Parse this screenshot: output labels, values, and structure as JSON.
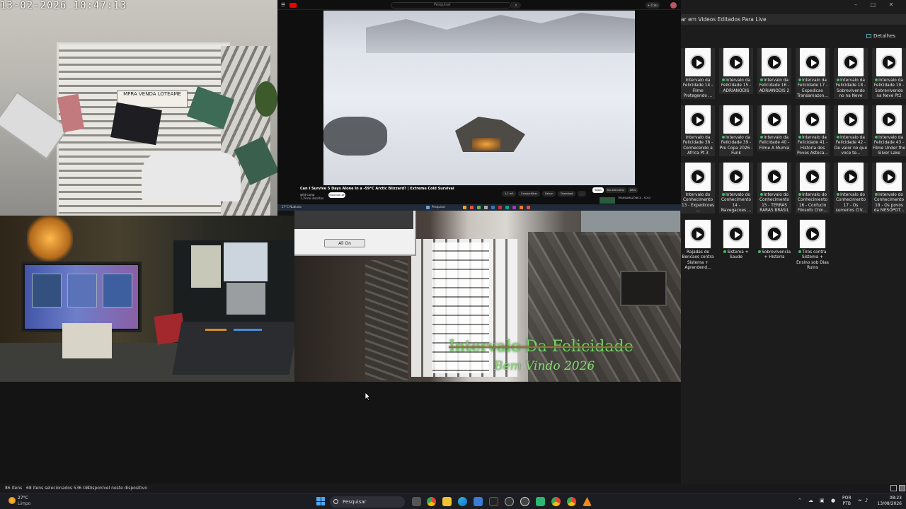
{
  "camera": {
    "timestamp": "13-02-2026  10:47:13",
    "sign_text": "MPRA  VENDA  LOTEAME"
  },
  "youtube": {
    "search_placeholder": "Pesquisar",
    "create_label": "+ Criar",
    "video_title": "Can I Survive 5 Days Alone In a -59°C Arctic Blizzard? | Extreme Cold Survival",
    "channel": "wild camp",
    "channel_subs": "7,79 mi inscritos",
    "subscribe_label": "Inscrever-se",
    "actions": [
      "1,1 mil",
      "Compartilhar",
      "Salvar",
      "Download",
      "..."
    ],
    "chips": [
      {
        "label": "Todos",
        "active": true
      },
      {
        "label": "Do wild camp",
        "active": false
      },
      {
        "label": "Afins",
        "active": false
      }
    ],
    "suggestion_title": "TRANSAMAZÔNICA - SOLO"
  },
  "mini_taskbar": {
    "search": "Pesquisar",
    "left_text": "27°C Nublado"
  },
  "room": {
    "dialog_button": "All On",
    "overlay_line1": "Intervalo Da Felicidade",
    "overlay_line2": "Bem Vindo 2026"
  },
  "explorer": {
    "address": "ar em Videos Editados Para Live",
    "details_label": "Detalhes",
    "files": [
      {
        "name": "Intervalo da Felicidade 14 - Filme Protegendo ...",
        "synced": false
      },
      {
        "name": "Intervalo da Felicidade 15 - ADRIANODIS",
        "synced": true
      },
      {
        "name": "Intervalo da Felicidade 16 - ADRIANODIS 2",
        "synced": true
      },
      {
        "name": "Intervalo da Felicidade 17 - Expedicao Transamazon...",
        "synced": true
      },
      {
        "name": "Intervalo da Felicidade 18 - Sobrevivendo no na Neve",
        "synced": true
      },
      {
        "name": "Intervalo da Felicidade 19 - Sobrevivendo na Neve Pt2",
        "synced": true
      },
      {
        "name": "Intervalo da Felicidade 38 - Conhecendo a Africa Pt 3",
        "synced": false
      },
      {
        "name": "Intervalo da Felicidade 39 - Pre Copa 2026 - Funk",
        "synced": true
      },
      {
        "name": "Intervalo da Felicidade 40 - Filme A Mumia",
        "synced": true
      },
      {
        "name": "Intervalo da Felicidade 41 - Historia dos Povos Asteca...",
        "synced": true
      },
      {
        "name": "Intervalo da Felicidade 42 - De valor no que voce te...",
        "synced": true
      },
      {
        "name": "Intervalo da Felicidade 43 - Filme Under the Silver Lake",
        "synced": true
      },
      {
        "name": "Intervalo do Conhecimento 13 - Expedicoes ...",
        "synced": false
      },
      {
        "name": "Intervalo do Conhecimento 14 - Navegacoes ...",
        "synced": true
      },
      {
        "name": "Intervalo do Conhecimento 15 - TERRAS RARAS BRASIL",
        "synced": true
      },
      {
        "name": "Intervalo do Conhecimento 16 - Confucio Filosofo Chin...",
        "synced": true
      },
      {
        "name": "Intervalo do Conhecimento 17 - Os sumerios CIV...",
        "synced": true
      },
      {
        "name": "Intervalo do Conhecimento 18 - Os povos da MESOPOT...",
        "synced": true
      },
      {
        "name": "Rajadas de Bencaos contra Sistema + Aprendend...",
        "synced": false
      },
      {
        "name": "Sistema + Saude",
        "synced": true
      },
      {
        "name": "Sobrevivencia + Historia",
        "synced": true
      },
      {
        "name": "Tiros contra Sistema + Ensino sob Dias Ruins",
        "synced": true
      }
    ]
  },
  "statusbar": {
    "items_count": "86 itens",
    "selected": "68 itens selecionados  536 GB",
    "availability": "Disponível neste dispositivo"
  },
  "taskbar": {
    "temperature": "27°C",
    "condition": "Limpo",
    "search_label": "Pesquisar",
    "language": "POR",
    "layout": "PTB",
    "time": "08:23",
    "date": "13/08/2026"
  },
  "colors": {
    "accent": "#4ca6f5",
    "synced_dot": "#3dbd5d",
    "youtube_red": "#e00000",
    "overlay_green": "#7ad36a"
  }
}
